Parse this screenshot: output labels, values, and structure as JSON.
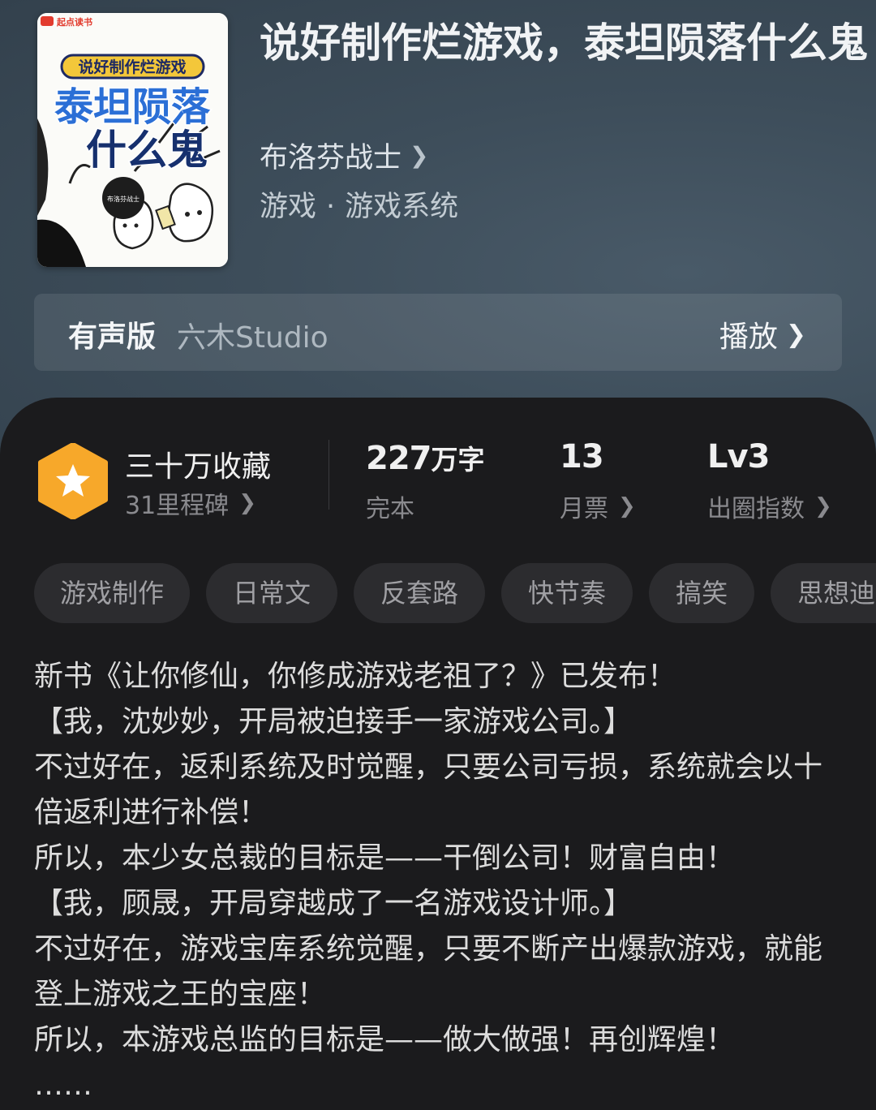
{
  "book": {
    "title": "说好制作烂游戏，泰坦陨落什么鬼",
    "author": "布洛芬战士",
    "genre_main": "游戏",
    "genre_sub": "游戏系统"
  },
  "cover": {
    "publisher": "起点读书",
    "title_small": "说好制作烂游戏",
    "title_line1": "泰坦陨落",
    "title_line2": "什么鬼",
    "author_stamp": "布洛芬战士"
  },
  "audio": {
    "label": "有声版",
    "studio": "六木Studio",
    "play_label": "播放"
  },
  "stats": {
    "favorites": "三十万收藏",
    "milestone": "31里程碑",
    "word_count_num": "227",
    "word_count_unit": "万字",
    "status": "完本",
    "monthly_votes": "13",
    "monthly_votes_label": "月票",
    "level": "Lv3",
    "level_label": "出圈指数"
  },
  "tags": [
    "游戏制作",
    "日常文",
    "反套路",
    "快节奏",
    "搞笑",
    "思想迪化"
  ],
  "description": [
    "新书《让你修仙，你修成游戏老祖了？》已发布！",
    "【我，沈妙妙，开局被迫接手一家游戏公司。】",
    "不过好在，返利系统及时觉醒，只要公司亏损，系统就会以十倍返利进行补偿！",
    "所以，本少女总裁的目标是——干倒公司！财富自由！",
    "【我，顾晟，开局穿越成了一名游戏设计师。】",
    "不过好在，游戏宝库系统觉醒，只要不断产出爆款游戏，就能登上游戏之王的宝座！",
    "所以，本游戏总监的目标是——做大做强！再创辉煌！",
    "……"
  ],
  "colors": {
    "hero_bg": "#3d4d5a",
    "panel_bg": "#1b1b1d",
    "badge_orange": "#f7a82a",
    "tag_bg": "#2c2c2f"
  }
}
